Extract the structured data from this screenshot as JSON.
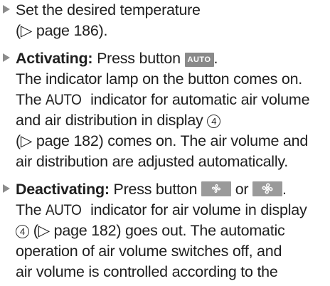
{
  "items": [
    {
      "lines": [
        "Set the desired temperature",
        "(▷ page 186)."
      ]
    },
    {
      "label": "Activating:",
      "line1_text": "Press button",
      "button": "AUTO",
      "line1_end": ".",
      "lines": [
        "The indicator lamp on the button comes on.",
        "indicator for automatic air volume",
        "and air distribution in display",
        "(▷ page 182) comes on. The air volume and",
        "air distribution are adjusted automatically."
      ],
      "auto_word": "AUTO",
      "the_word": "The",
      "circled_number": "4"
    },
    {
      "label": "Deactivating:",
      "line1_text": "Press button",
      "or_word": "or",
      "line1_end": ".",
      "the_word": "The",
      "auto_word": "AUTO",
      "line2_rest": "indicator for air volume in display",
      "circled_number": "4",
      "line3_rest": "(▷ page 182) goes out. The automatic",
      "lines": [
        "operation of air volume switches off, and",
        "air volume is controlled according to the"
      ]
    }
  ],
  "icons": [
    "triangle-bullet-icon",
    "fan-small-icon",
    "fan-large-icon"
  ]
}
